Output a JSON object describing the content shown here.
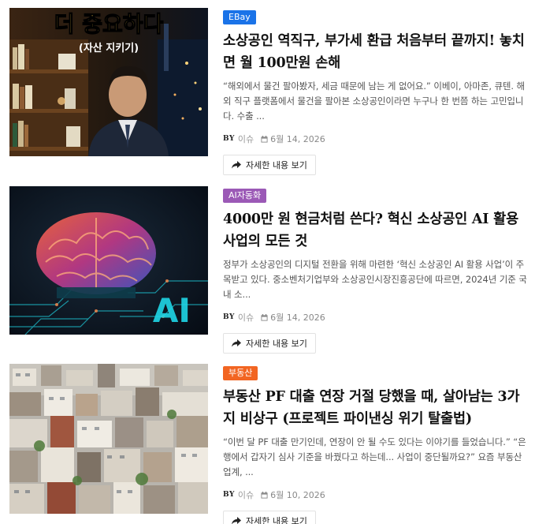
{
  "posts": [
    {
      "category": "EBay",
      "category_color": "#1a73e8",
      "thumb_caption_main": "더 중요하다",
      "thumb_caption_sub": "(자산 지키기)",
      "title": "소상공인 역직구, 부가세 환급 처음부터 끝까지! 놓치면 월 100만원 손해",
      "excerpt": "“해외에서 물건 팔아봤자, 세금 때문에 남는 게 없어요.” 이베이, 아마존, 큐텐. 해외 직구 플랫폼에서 물건을 팔아본 소상공인이라면 누구나 한 번쯤 하는 고민입니다. 수출 ...",
      "by": "BY",
      "author": "이슈",
      "date": "6월 14, 2026",
      "readmore": "자세한 내용 보기"
    },
    {
      "category": "AI자동화",
      "category_color": "#9b59b6",
      "thumb_caption_main": "AI",
      "title": "4000만 원 현금처럼 쓴다? 혁신 소상공인 AI 활용 사업의 모든 것",
      "excerpt": "정부가 소상공인의 디지털 전환을 위해 마련한 ‘혁신 소상공인 AI 활용 사업’이 주목받고 있다. 중소벤처기업부와 소상공인시장진흥공단에 따르면, 2024년 기준 국내 소...",
      "by": "BY",
      "author": "이슈",
      "date": "6월 14, 2026",
      "readmore": "자세한 내용 보기"
    },
    {
      "category": "부동산",
      "category_color": "#f26522",
      "title": "부동산 PF 대출 연장 거절 당했을 때, 살아남는 3가지 비상구 (프로젝트 파이낸싱 위기 탈출법)",
      "excerpt": "“이번 달 PF 대출 만기인데, 연장이 안 될 수도 있다는 이야기를 들었습니다.” “은행에서 갑자기 심사 기준을 바꿨다고 하는데... 사업이 중단될까요?” 요즘 부동산 업계, ...",
      "by": "BY",
      "author": "이슈",
      "date": "6월 10, 2026",
      "readmore": "자세한 내용 보기"
    }
  ]
}
